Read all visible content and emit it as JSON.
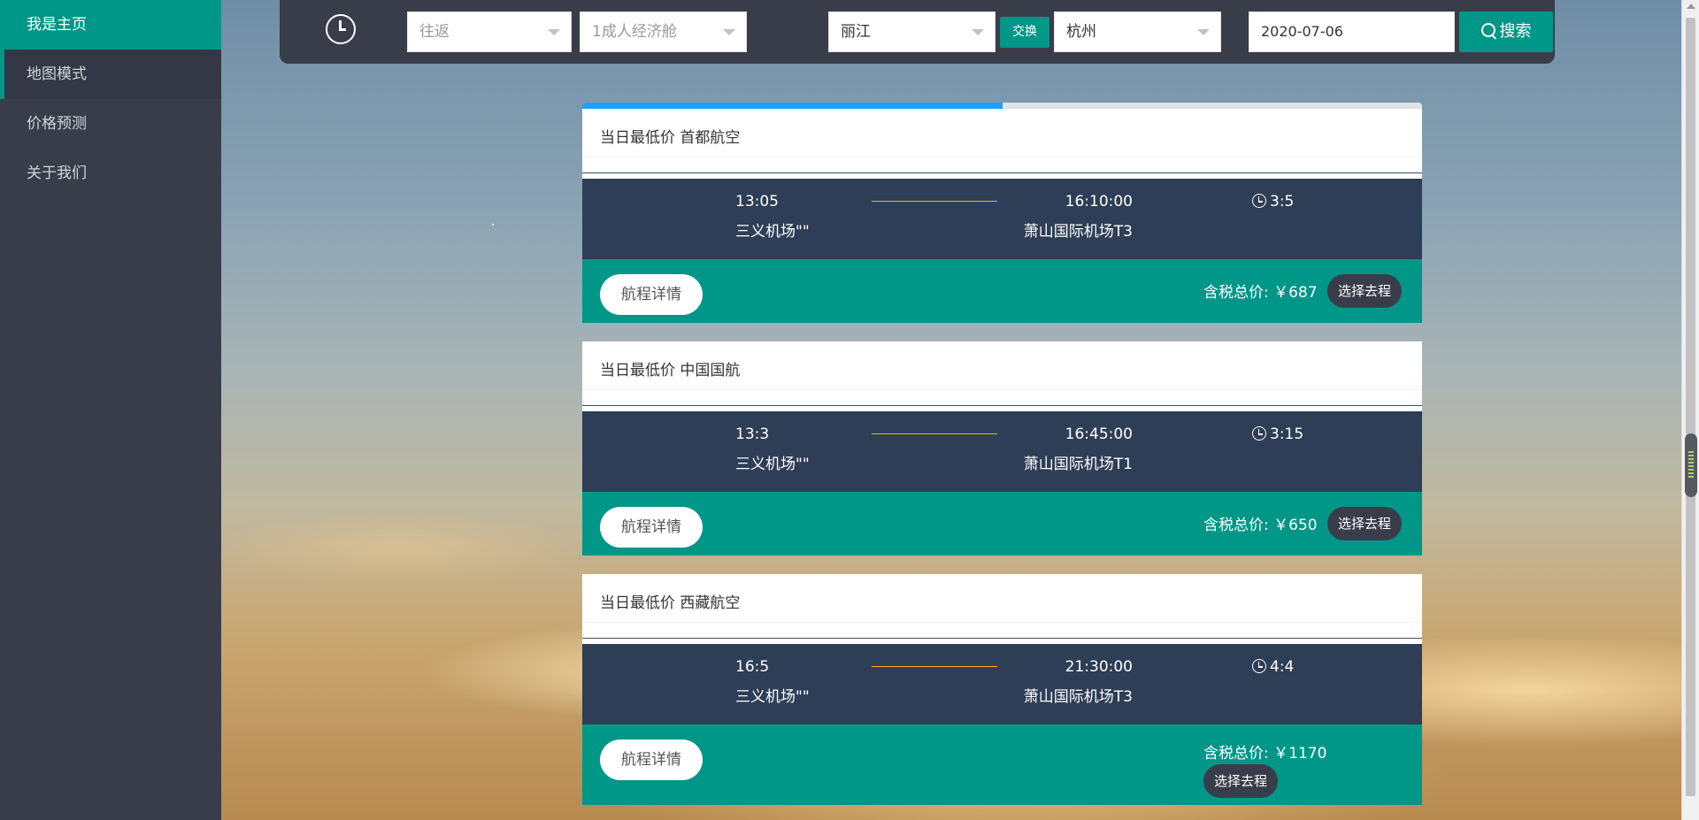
{
  "sidebar": {
    "items": [
      {
        "label": "我是主页"
      },
      {
        "label": "地图模式"
      },
      {
        "label": "价格预测"
      },
      {
        "label": "关于我们"
      }
    ]
  },
  "search": {
    "trip_type_placeholder": "往返",
    "cabin_placeholder": "1成人经济舱",
    "from_city": "丽江",
    "swap_label": "交换",
    "to_city": "杭州",
    "date": "2020-07-06",
    "search_label": "搜索"
  },
  "progress_fraction": 0.5,
  "flights": [
    {
      "title": "当日最低价 首都航空",
      "dep_time": "13:05",
      "dep_airport": "三义机场\"\"",
      "arr_time": "16:10:00",
      "arr_airport": "萧山国际机场T3",
      "duration": "3:5",
      "price_label": "含税总价: ￥687",
      "detail_label": "航程详情",
      "select_label": "选择去程"
    },
    {
      "title": "当日最低价 中国国航",
      "dep_time": "13:3",
      "dep_airport": "三义机场\"\"",
      "arr_time": "16:45:00",
      "arr_airport": "萧山国际机场T1",
      "duration": "3:15",
      "price_label": "含税总价: ￥650",
      "detail_label": "航程详情",
      "select_label": "选择去程"
    },
    {
      "title": "当日最低价 西藏航空",
      "dep_time": "16:5",
      "dep_airport": "三义机场\"\"",
      "arr_time": "21:30:00",
      "arr_airport": "萧山国际机场T3",
      "duration": "4:4",
      "price_label": "含税总价: ￥1170",
      "detail_label": "航程详情",
      "select_label": "选择去程"
    }
  ],
  "colors": {
    "accent": "#009688",
    "sidebar": "#393d4a",
    "card_body": "#2e3e56",
    "progress": "#1e9fff",
    "flight_line": "#f5b400"
  }
}
